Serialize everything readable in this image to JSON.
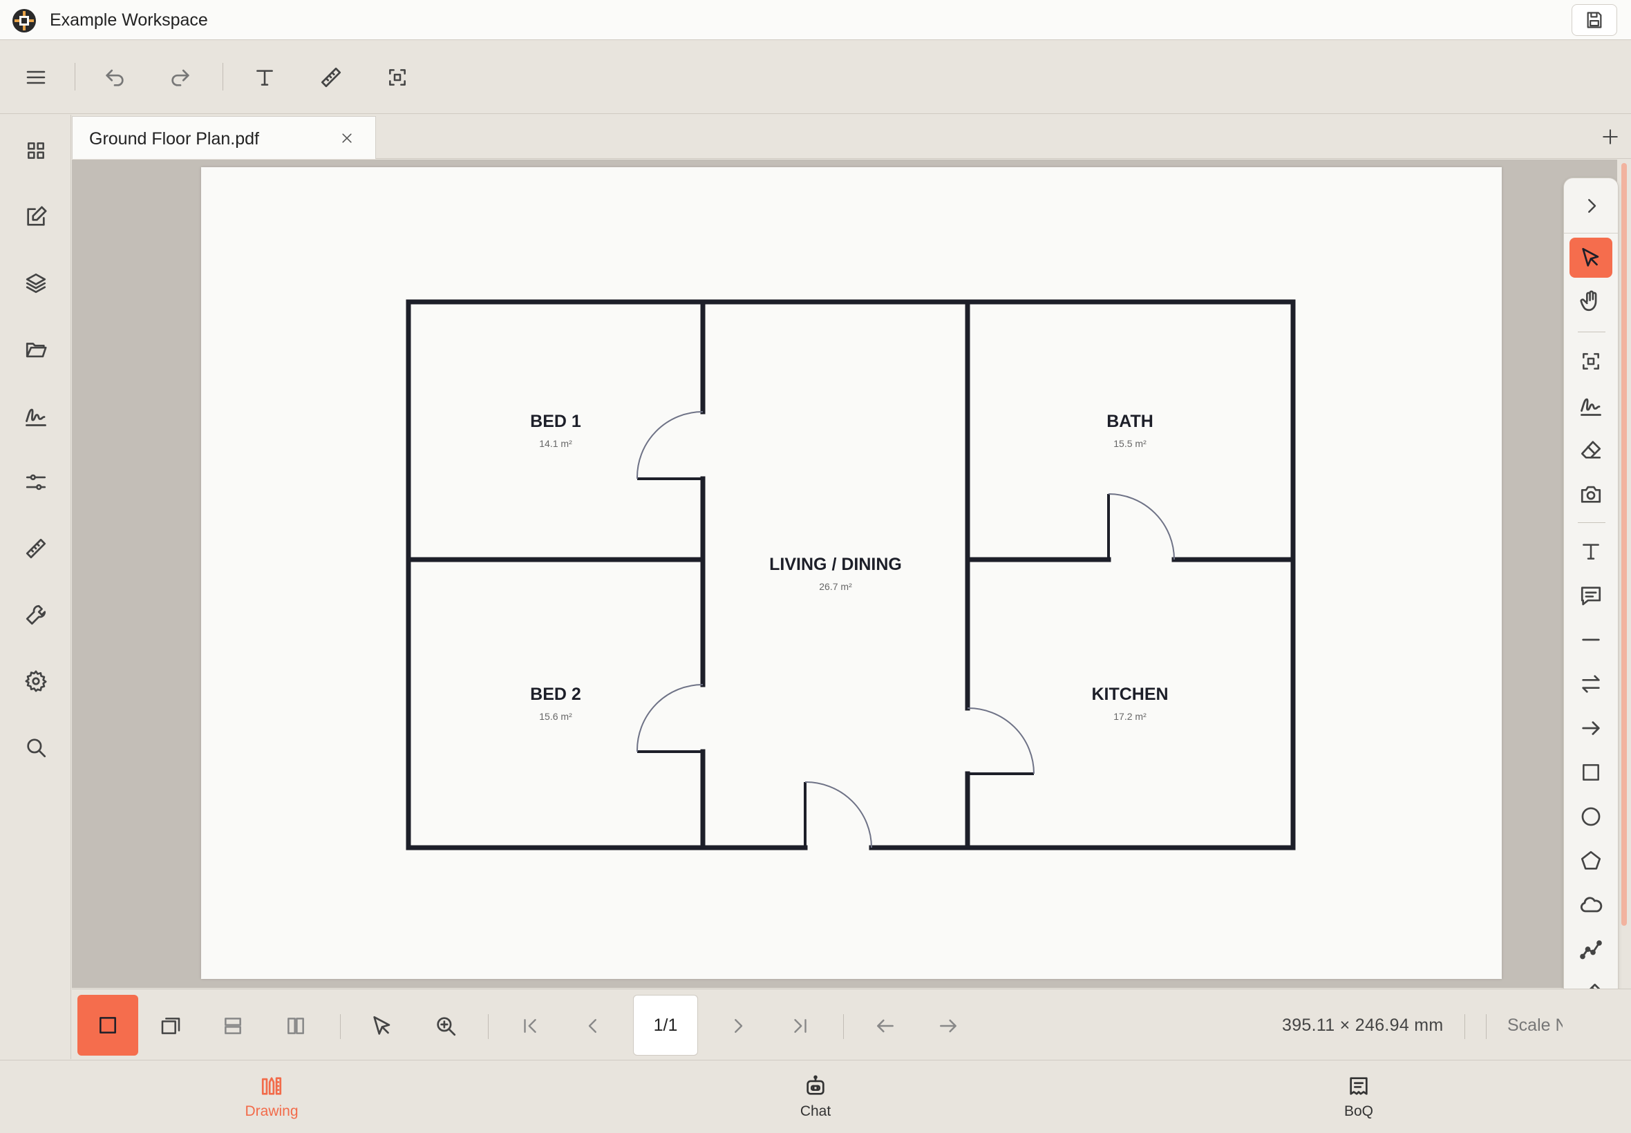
{
  "app": {
    "title": "Example Workspace"
  },
  "document": {
    "tab_label": "Ground Floor Plan.pdf",
    "rooms": [
      {
        "name": "BED 1",
        "area": "14.1 m²"
      },
      {
        "name": "BED 2",
        "area": "15.6 m²"
      },
      {
        "name": "LIVING / DINING",
        "area": "26.7 m²"
      },
      {
        "name": "BATH",
        "area": "15.5 m²"
      },
      {
        "name": "KITCHEN",
        "area": "17.2 m²"
      }
    ]
  },
  "toolbar": {
    "icons": [
      "menu-icon",
      "undo-icon",
      "redo-icon",
      "text-icon",
      "ruler-icon",
      "select-region-icon"
    ]
  },
  "sidebar": {
    "icons": [
      "grid-icon",
      "edit-icon",
      "layers-icon",
      "folder-icon",
      "signature-icon",
      "sliders-icon",
      "ruler-icon",
      "wrench-icon",
      "gear-icon",
      "search-icon"
    ]
  },
  "palette": {
    "active_tool": "select",
    "icons": [
      "chevron-right-icon",
      "pointer-icon",
      "hand-icon",
      "select-region-icon",
      "signature-icon",
      "eraser-icon",
      "camera-icon",
      "text-icon",
      "comment-icon",
      "line-icon",
      "double-arrow-icon",
      "arrow-icon",
      "rectangle-icon",
      "circle-icon",
      "polygon-icon",
      "cloud-icon",
      "polyline-icon",
      "pencil-icon",
      "chevron-up-icon"
    ]
  },
  "viewbar": {
    "page_indicator": "1/1",
    "page_dimensions": "395.11 × 246.94 mm",
    "scale_label": "Scale N"
  },
  "bottom_nav": {
    "items": [
      {
        "label": "Drawing",
        "active": true
      },
      {
        "label": "Chat",
        "active": false
      },
      {
        "label": "BoQ",
        "active": false
      }
    ]
  },
  "colors": {
    "accent": "#f56d4d",
    "background": "#e8e4dd",
    "canvas": "#c3beb7",
    "page": "#fafaf8",
    "walls": "#1d1f29"
  }
}
